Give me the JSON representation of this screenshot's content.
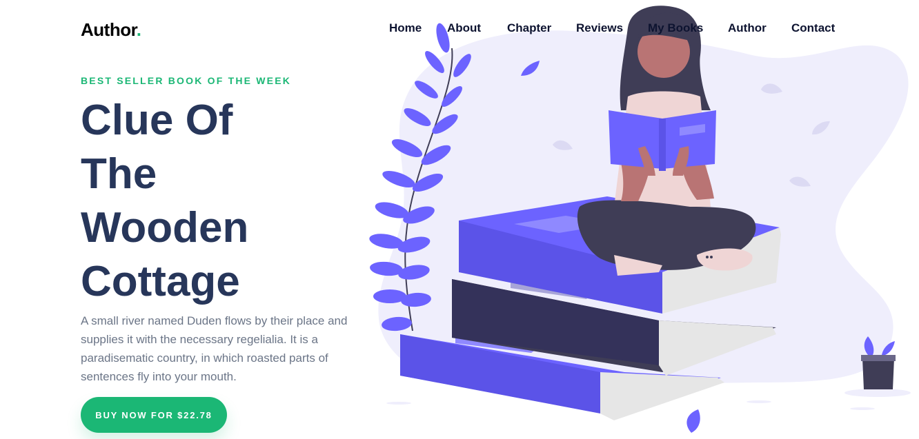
{
  "brand": {
    "name": "Author",
    "dot": "."
  },
  "nav": {
    "items": [
      "Home",
      "About",
      "Chapter",
      "Reviews",
      "My Books",
      "Author",
      "Contact"
    ]
  },
  "hero": {
    "kicker": "BEST SELLER BOOK OF THE WEEK",
    "title_lines": [
      "Clue Of",
      "The",
      "Wooden",
      "Cottage"
    ],
    "description": "A small river named Duden flows by their place and supplies it with the necessary regelialia. It is a paradisematic country, in which roasted parts of sentences fly into your mouth.",
    "cta_label": "BUY NOW FOR $22.78"
  },
  "colors": {
    "accent": "#1bb775",
    "title": "#27365a",
    "book": "#6c63ff",
    "blob": "#eeeefd"
  },
  "illustration": {
    "subject": "woman-reading-on-stack-of-books"
  }
}
